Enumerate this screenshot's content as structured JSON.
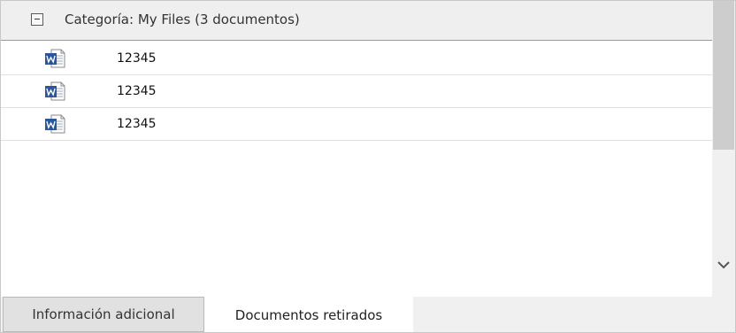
{
  "group": {
    "title": "Categoría: My Files (3 documentos)",
    "collapse_icon": "minus-box-icon"
  },
  "documents": [
    {
      "icon": "word-document-icon",
      "name": "12345"
    },
    {
      "icon": "word-document-icon",
      "name": "12345"
    },
    {
      "icon": "word-document-icon",
      "name": "12345"
    }
  ],
  "scrollbar": {
    "down_icon": "chevron-down-icon",
    "position_fraction": 0.0
  },
  "tabs": [
    {
      "label": "Información adicional",
      "active": false
    },
    {
      "label": "Documentos retirados",
      "active": true
    }
  ],
  "colors": {
    "word_blue": "#2b579a",
    "header_bg": "#efefef"
  }
}
